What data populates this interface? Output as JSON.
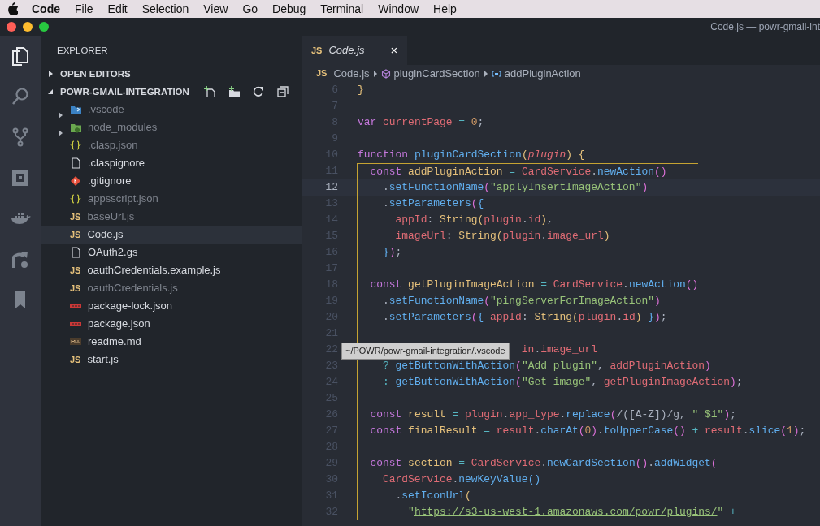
{
  "menu_bar": {
    "app": "Code",
    "items": [
      "File",
      "Edit",
      "Selection",
      "View",
      "Go",
      "Debug",
      "Terminal",
      "Window",
      "Help"
    ]
  },
  "window": {
    "title": "Code.js — powr-gmail-int"
  },
  "activity_bar": [
    {
      "kind": "files",
      "selected": true
    },
    {
      "kind": "search",
      "selected": false
    },
    {
      "kind": "source-control",
      "selected": false
    },
    {
      "kind": "extensions",
      "selected": false
    },
    {
      "kind": "docker",
      "selected": false
    },
    {
      "kind": "remote",
      "selected": false
    },
    {
      "kind": "bookmark",
      "selected": false
    }
  ],
  "sidebar": {
    "title": "EXPLORER",
    "sections": [
      {
        "label": "OPEN EDITORS",
        "expanded": false
      },
      {
        "label": "POWR-GMAIL-INTEGRATION",
        "expanded": true
      }
    ],
    "files": [
      {
        "name": ".vscode",
        "kind": "vscode-folder",
        "expanded": false,
        "dimmed": true,
        "selected": false
      },
      {
        "name": "node_modules",
        "kind": "node-folder",
        "expanded": false,
        "dimmed": true,
        "selected": false
      },
      {
        "name": ".clasp.json",
        "kind": "json",
        "dimmed": true,
        "selected": false
      },
      {
        "name": ".claspignore",
        "kind": "file",
        "dimmed": false,
        "selected": false
      },
      {
        "name": ".gitignore",
        "kind": "git",
        "dimmed": false,
        "selected": false
      },
      {
        "name": "appsscript.json",
        "kind": "json",
        "dimmed": true,
        "selected": false
      },
      {
        "name": "baseUrl.js",
        "kind": "js",
        "badge": "JS",
        "dimmed": true,
        "selected": false
      },
      {
        "name": "Code.js",
        "kind": "js",
        "badge": "JS",
        "dimmed": false,
        "selected": true
      },
      {
        "name": "OAuth2.gs",
        "kind": "file",
        "dimmed": false,
        "selected": false
      },
      {
        "name": "oauthCredentials.example.js",
        "kind": "js",
        "badge": "JS",
        "dimmed": false,
        "selected": false
      },
      {
        "name": "oauthCredentials.js",
        "kind": "js",
        "badge": "JS",
        "dimmed": true,
        "selected": false
      },
      {
        "name": "package-lock.json",
        "kind": "npm",
        "dimmed": false,
        "selected": false
      },
      {
        "name": "package.json",
        "kind": "npm",
        "dimmed": false,
        "selected": false
      },
      {
        "name": "readme.md",
        "kind": "markdown",
        "dimmed": false,
        "selected": false
      },
      {
        "name": "start.js",
        "kind": "js",
        "badge": "JS",
        "dimmed": false,
        "selected": false
      }
    ]
  },
  "tabs": [
    {
      "badge": "JS",
      "label": "Code.js",
      "selected": true,
      "preview": true,
      "close": "×"
    }
  ],
  "breadcrumbs": [
    {
      "kind": "js",
      "label": "Code.js",
      "badge": "JS"
    },
    {
      "kind": "function",
      "label": "pluginCardSection"
    },
    {
      "kind": "variable",
      "label": "addPluginAction"
    }
  ],
  "editor": {
    "lines": [
      {
        "n": "6",
        "current": false,
        "scope": false,
        "tokens": [
          {
            "text": "}",
            "kind": "b1"
          }
        ]
      },
      {
        "n": "7",
        "current": false,
        "scope": false
      },
      {
        "n": "8",
        "current": false,
        "scope": false,
        "tokens": [
          {
            "text": "var",
            "kind": "kw"
          },
          {
            "text": " currentPage",
            "kind": "var"
          },
          {
            "text": " = ",
            "kind": "op"
          },
          {
            "text": "0",
            "kind": "num"
          },
          {
            "text": ";",
            "kind": "p"
          }
        ]
      },
      {
        "n": "9",
        "current": false,
        "scope": false
      },
      {
        "n": "10",
        "current": false,
        "scope": false,
        "tokens": [
          {
            "text": "function",
            "kind": "kw"
          },
          {
            "text": " pluginCardSection",
            "kind": "fn"
          },
          {
            "text": "(",
            "kind": "b1"
          },
          {
            "text": "plugin",
            "kind": "param"
          },
          {
            "text": ")",
            "kind": "b1"
          },
          {
            "text": " {",
            "kind": "b1"
          }
        ]
      },
      {
        "n": "11",
        "current": false,
        "scope": true,
        "tokens": [
          {
            "text": "  const",
            "kind": "kw"
          },
          {
            "text": " addPluginAction",
            "kind": "def"
          },
          {
            "text": " = ",
            "kind": "op"
          },
          {
            "text": "CardService",
            "kind": "var"
          },
          {
            "text": ".",
            "kind": "p"
          },
          {
            "text": "newAction",
            "kind": "fn"
          },
          {
            "text": "()",
            "kind": "b2"
          }
        ]
      },
      {
        "n": "12",
        "current": true,
        "scope": true,
        "tokens": [
          {
            "text": "    .",
            "kind": "p"
          },
          {
            "text": "setFunctionName",
            "kind": "fn"
          },
          {
            "text": "(",
            "kind": "b2"
          },
          {
            "text": "\"applyInsertImageAction\"",
            "kind": "str"
          },
          {
            "text": ")",
            "kind": "b2"
          }
        ]
      },
      {
        "n": "13",
        "current": false,
        "scope": true,
        "tokens": [
          {
            "text": "    .",
            "kind": "p"
          },
          {
            "text": "setParameters",
            "kind": "fn"
          },
          {
            "text": "(",
            "kind": "b2"
          },
          {
            "text": "{",
            "kind": "b3"
          }
        ]
      },
      {
        "n": "14",
        "current": false,
        "scope": true,
        "tokens": [
          {
            "text": "      appId",
            "kind": "var"
          },
          {
            "text": ": ",
            "kind": "p"
          },
          {
            "text": "String",
            "kind": "def"
          },
          {
            "text": "(",
            "kind": "b1"
          },
          {
            "text": "plugin",
            "kind": "var"
          },
          {
            "text": ".",
            "kind": "p"
          },
          {
            "text": "id",
            "kind": "var"
          },
          {
            "text": ")",
            "kind": "b1"
          },
          {
            "text": ",",
            "kind": "p"
          }
        ]
      },
      {
        "n": "15",
        "current": false,
        "scope": true,
        "tokens": [
          {
            "text": "      imageUrl",
            "kind": "var"
          },
          {
            "text": ": ",
            "kind": "p"
          },
          {
            "text": "String",
            "kind": "def"
          },
          {
            "text": "(",
            "kind": "b1"
          },
          {
            "text": "plugin",
            "kind": "var"
          },
          {
            "text": ".",
            "kind": "p"
          },
          {
            "text": "image_url",
            "kind": "var"
          },
          {
            "text": ")",
            "kind": "b1"
          }
        ]
      },
      {
        "n": "16",
        "current": false,
        "scope": true,
        "tokens": [
          {
            "text": "    }",
            "kind": "b3"
          },
          {
            "text": ")",
            "kind": "b2"
          },
          {
            "text": ";",
            "kind": "p"
          }
        ]
      },
      {
        "n": "17",
        "current": false,
        "scope": true
      },
      {
        "n": "18",
        "current": false,
        "scope": true,
        "tokens": [
          {
            "text": "  const",
            "kind": "kw"
          },
          {
            "text": " getPluginImageAction",
            "kind": "def"
          },
          {
            "text": " = ",
            "kind": "op"
          },
          {
            "text": "CardService",
            "kind": "var"
          },
          {
            "text": ".",
            "kind": "p"
          },
          {
            "text": "newAction",
            "kind": "fn"
          },
          {
            "text": "()",
            "kind": "b2"
          }
        ]
      },
      {
        "n": "19",
        "current": false,
        "scope": true,
        "tokens": [
          {
            "text": "    .",
            "kind": "p"
          },
          {
            "text": "setFunctionName",
            "kind": "fn"
          },
          {
            "text": "(",
            "kind": "b2"
          },
          {
            "text": "\"pingServerForImageAction\"",
            "kind": "str"
          },
          {
            "text": ")",
            "kind": "b2"
          }
        ]
      },
      {
        "n": "20",
        "current": false,
        "scope": true,
        "tokens": [
          {
            "text": "    .",
            "kind": "p"
          },
          {
            "text": "setParameters",
            "kind": "fn"
          },
          {
            "text": "(",
            "kind": "b2"
          },
          {
            "text": "{",
            "kind": "b3"
          },
          {
            "text": " appId",
            "kind": "var"
          },
          {
            "text": ": ",
            "kind": "p"
          },
          {
            "text": "String",
            "kind": "def"
          },
          {
            "text": "(",
            "kind": "b1"
          },
          {
            "text": "plugin",
            "kind": "var"
          },
          {
            "text": ".",
            "kind": "p"
          },
          {
            "text": "id",
            "kind": "var"
          },
          {
            "text": ")",
            "kind": "b1"
          },
          {
            "text": " }",
            "kind": "b3"
          },
          {
            "text": ")",
            "kind": "b2"
          },
          {
            "text": ";",
            "kind": "p"
          }
        ]
      },
      {
        "n": "21",
        "current": false,
        "scope": true
      },
      {
        "n": "22",
        "current": false,
        "scope": true,
        "tooltip": "~/POWR/powr-gmail-integration/.vscode",
        "tokens": [
          {
            "text": "                          in",
            "kind": "var"
          },
          {
            "text": ".",
            "kind": "p"
          },
          {
            "text": "image_url",
            "kind": "var"
          }
        ]
      },
      {
        "n": "23",
        "current": false,
        "scope": true,
        "tokens": [
          {
            "text": "    ?",
            "kind": "op"
          },
          {
            "text": " getButtonWithAction",
            "kind": "fn"
          },
          {
            "text": "(",
            "kind": "b2"
          },
          {
            "text": "\"Add plugin\"",
            "kind": "str"
          },
          {
            "text": ", ",
            "kind": "p"
          },
          {
            "text": "addPluginAction",
            "kind": "var"
          },
          {
            "text": ")",
            "kind": "b2"
          }
        ]
      },
      {
        "n": "24",
        "current": false,
        "scope": true,
        "tokens": [
          {
            "text": "    :",
            "kind": "op"
          },
          {
            "text": " getButtonWithAction",
            "kind": "fn"
          },
          {
            "text": "(",
            "kind": "b2"
          },
          {
            "text": "\"Get image\"",
            "kind": "str"
          },
          {
            "text": ", ",
            "kind": "p"
          },
          {
            "text": "getPluginImageAction",
            "kind": "var"
          },
          {
            "text": ")",
            "kind": "b2"
          },
          {
            "text": ";",
            "kind": "p"
          }
        ]
      },
      {
        "n": "25",
        "current": false,
        "scope": true
      },
      {
        "n": "26",
        "current": false,
        "scope": true,
        "tokens": [
          {
            "text": "  const",
            "kind": "kw"
          },
          {
            "text": " result",
            "kind": "def"
          },
          {
            "text": " = ",
            "kind": "op"
          },
          {
            "text": "plugin",
            "kind": "var"
          },
          {
            "text": ".",
            "kind": "p"
          },
          {
            "text": "app_type",
            "kind": "var"
          },
          {
            "text": ".",
            "kind": "p"
          },
          {
            "text": "replace",
            "kind": "fn"
          },
          {
            "text": "(",
            "kind": "b2"
          },
          {
            "text": "/([A-Z])/g",
            "kind": "re"
          },
          {
            "text": ", ",
            "kind": "p"
          },
          {
            "text": "\" $1\"",
            "kind": "str"
          },
          {
            "text": ")",
            "kind": "b2"
          },
          {
            "text": ";",
            "kind": "p"
          }
        ]
      },
      {
        "n": "27",
        "current": false,
        "scope": true,
        "tokens": [
          {
            "text": "  const",
            "kind": "kw"
          },
          {
            "text": " finalResult",
            "kind": "def"
          },
          {
            "text": " = ",
            "kind": "op"
          },
          {
            "text": "result",
            "kind": "var"
          },
          {
            "text": ".",
            "kind": "p"
          },
          {
            "text": "charAt",
            "kind": "fn"
          },
          {
            "text": "(",
            "kind": "b2"
          },
          {
            "text": "0",
            "kind": "num"
          },
          {
            "text": ")",
            "kind": "b2"
          },
          {
            "text": ".",
            "kind": "p"
          },
          {
            "text": "toUpperCase",
            "kind": "fn"
          },
          {
            "text": "()",
            "kind": "b2"
          },
          {
            "text": " + ",
            "kind": "op"
          },
          {
            "text": "result",
            "kind": "var"
          },
          {
            "text": ".",
            "kind": "p"
          },
          {
            "text": "slice",
            "kind": "fn"
          },
          {
            "text": "(",
            "kind": "b2"
          },
          {
            "text": "1",
            "kind": "num"
          },
          {
            "text": ")",
            "kind": "b2"
          },
          {
            "text": ";",
            "kind": "p"
          }
        ]
      },
      {
        "n": "28",
        "current": false,
        "scope": true
      },
      {
        "n": "29",
        "current": false,
        "scope": true,
        "tokens": [
          {
            "text": "  const",
            "kind": "kw"
          },
          {
            "text": " section",
            "kind": "def"
          },
          {
            "text": " = ",
            "kind": "op"
          },
          {
            "text": "CardService",
            "kind": "var"
          },
          {
            "text": ".",
            "kind": "p"
          },
          {
            "text": "newCardSection",
            "kind": "fn"
          },
          {
            "text": "()",
            "kind": "b2"
          },
          {
            "text": ".",
            "kind": "p"
          },
          {
            "text": "addWidget",
            "kind": "fn"
          },
          {
            "text": "(",
            "kind": "b2"
          }
        ]
      },
      {
        "n": "30",
        "current": false,
        "scope": true,
        "tokens": [
          {
            "text": "    CardService",
            "kind": "var"
          },
          {
            "text": ".",
            "kind": "p"
          },
          {
            "text": "newKeyValue",
            "kind": "fn"
          },
          {
            "text": "()",
            "kind": "b3"
          }
        ]
      },
      {
        "n": "31",
        "current": false,
        "scope": true,
        "tokens": [
          {
            "text": "      .",
            "kind": "p"
          },
          {
            "text": "setIconUrl",
            "kind": "fn"
          },
          {
            "text": "(",
            "kind": "b1"
          }
        ]
      },
      {
        "n": "32",
        "current": false,
        "scope": true,
        "tokens": [
          {
            "text": "        \"",
            "kind": "str"
          },
          {
            "text": "https://s3-us-west-1.amazonaws.com/powr/plugins/",
            "kind": "link"
          },
          {
            "text": "\"",
            "kind": "str"
          },
          {
            "text": " +",
            "kind": "op"
          }
        ]
      }
    ]
  }
}
